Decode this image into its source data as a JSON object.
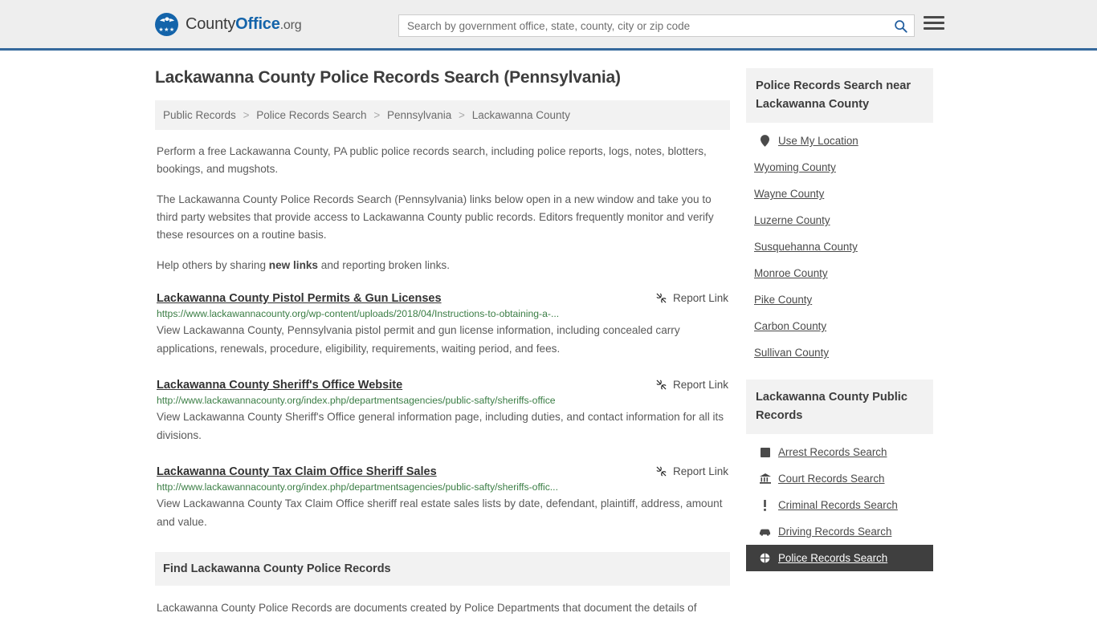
{
  "header": {
    "logo": {
      "part1": "County",
      "part2": "Office",
      "part3": ".org",
      "stars": "★★★"
    },
    "search": {
      "placeholder": "Search by government office, state, county, city or zip code",
      "value": "",
      "button_icon": "search-icon"
    },
    "menu_icon": "hamburger-menu-icon"
  },
  "page": {
    "title": "Lackawanna County Police Records Search (Pennsylvania)"
  },
  "breadcrumb": {
    "items": [
      {
        "label": "Public Records"
      },
      {
        "label": "Police Records Search"
      },
      {
        "label": "Pennsylvania"
      },
      {
        "label": "Lackawanna County"
      }
    ],
    "separator": ">"
  },
  "intro": {
    "p1": "Perform a free Lackawanna County, PA public police records search, including police reports, logs, notes, blotters, bookings, and mugshots.",
    "p2": "The Lackawanna County Police Records Search (Pennsylvania) links below open in a new window and take you to third party websites that provide access to Lackawanna County public records. Editors frequently monitor and verify these resources on a routine basis.",
    "p3_before": "Help others by sharing ",
    "p3_link": "new links",
    "p3_after": " and reporting broken links."
  },
  "results": {
    "report_label": "Report Link",
    "report_icon": "broken-link-icon",
    "items": [
      {
        "title": "Lackawanna County Pistol Permits & Gun Licenses",
        "url": "https://www.lackawannacounty.org/wp-content/uploads/2018/04/Instructions-to-obtaining-a-...",
        "description": "View Lackawanna County, Pennsylvania pistol permit and gun license information, including concealed carry applications, renewals, procedure, eligibility, requirements, waiting period, and fees."
      },
      {
        "title": "Lackawanna County Sheriff's Office Website",
        "url": "http://www.lackawannacounty.org/index.php/departmentsagencies/public-safty/sheriffs-office",
        "description": "View Lackawanna County Sheriff's Office general information page, including duties, and contact information for all its divisions."
      },
      {
        "title": "Lackawanna County Tax Claim Office Sheriff Sales",
        "url": "http://www.lackawannacounty.org/index.php/departmentsagencies/public-safty/sheriffs-offic...",
        "description": "View Lackawanna County Tax Claim Office sheriff real estate sales lists by date, defendant, plaintiff, address, amount and value."
      }
    ]
  },
  "find_section": {
    "heading": "Find Lackawanna County Police Records",
    "body": "Lackawanna County Police Records are documents created by Police Departments that document the details of"
  },
  "sidebar": {
    "nearby": {
      "heading": "Police Records Search near Lackawanna County",
      "items": [
        {
          "label": "Use My Location",
          "icon": "map-pin-icon"
        },
        {
          "label": "Wyoming County",
          "icon": ""
        },
        {
          "label": "Wayne County",
          "icon": ""
        },
        {
          "label": "Luzerne County",
          "icon": ""
        },
        {
          "label": "Susquehanna County",
          "icon": ""
        },
        {
          "label": "Monroe County",
          "icon": ""
        },
        {
          "label": "Pike County",
          "icon": ""
        },
        {
          "label": "Carbon County",
          "icon": ""
        },
        {
          "label": "Sullivan County",
          "icon": ""
        }
      ]
    },
    "public_records": {
      "heading": "Lackawanna County Public Records",
      "items": [
        {
          "label": "Arrest Records Search",
          "icon": "fingerprint-icon",
          "active": false
        },
        {
          "label": "Court Records Search",
          "icon": "courthouse-icon",
          "active": false
        },
        {
          "label": "Criminal Records Search",
          "icon": "exclamation-icon",
          "active": false
        },
        {
          "label": "Driving Records Search",
          "icon": "car-icon",
          "active": false
        },
        {
          "label": "Police Records Search",
          "icon": "badge-icon",
          "active": true
        }
      ]
    }
  },
  "colors": {
    "brand_blue": "#1464aa",
    "header_border": "#35699c",
    "url_green": "#3a7d44",
    "active_bg": "#3f3f3f"
  }
}
